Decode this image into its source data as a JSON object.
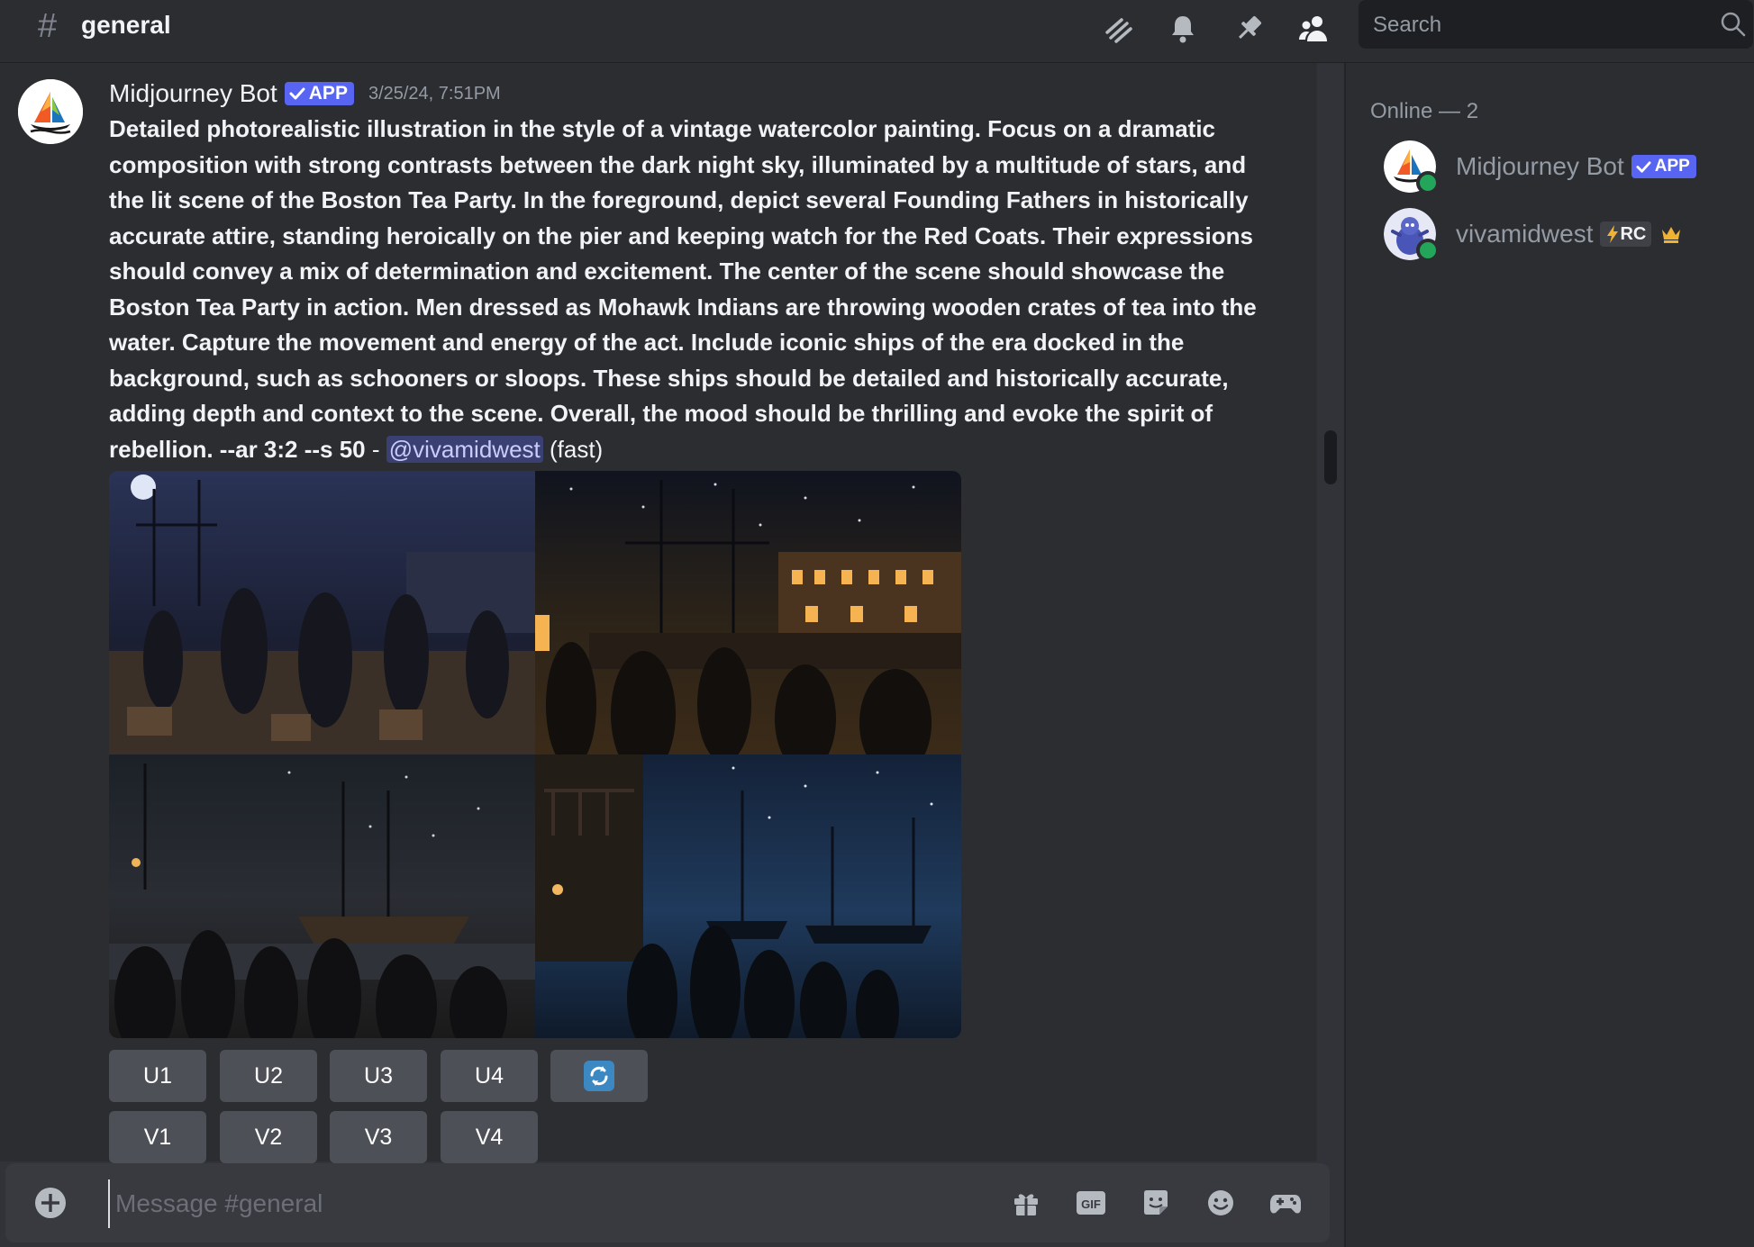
{
  "header": {
    "channel_symbol": "#",
    "channel_name": "general",
    "icons": [
      "threads-icon",
      "bell-icon",
      "pin-icon",
      "members-icon"
    ],
    "search_placeholder": "Search"
  },
  "message": {
    "author": "Midjourney Bot",
    "badge": "APP",
    "timestamp": "3/25/24, 7:51PM",
    "prompt": "Detailed photorealistic illustration in the style of a vintage watercolor painting. Focus on a dramatic composition with strong contrasts between the dark night sky, illuminated by a multitude of stars, and the lit scene of the Boston Tea Party. In the foreground, depict several Founding Fathers in historically accurate attire, standing heroically on the pier and keeping watch for the Red Coats. Their expressions should convey a mix of determination and excitement. The center of the scene should showcase the Boston Tea Party in action. Men dressed as Mohawk Indians are throwing wooden crates of tea into the water. Capture the movement and energy of the act. Include iconic ships of the era docked in the background, such as schooners or sloops. These ships should be detailed and historically accurate, adding depth and context to the scene. Overall, the mood should be thrilling and evoke the spirit of rebellion. --ar 3:2 --s 50",
    "separator": " - ",
    "mention": "@vivamidwest",
    "speed": "(fast)"
  },
  "buttons": {
    "upscale": [
      "U1",
      "U2",
      "U3",
      "U4"
    ],
    "variation": [
      "V1",
      "V2",
      "V3",
      "V4"
    ],
    "reroll_icon": "refresh-icon"
  },
  "composer": {
    "placeholder": "Message #general",
    "icons": [
      "gift-icon",
      "gif-icon",
      "sticker-icon",
      "emoji-icon",
      "game-controller-icon"
    ],
    "gif_label": "GIF"
  },
  "members": {
    "online_header": "Online — 2",
    "list": [
      {
        "name": "Midjourney Bot",
        "badge": "APP",
        "status": "online"
      },
      {
        "name": "vivamidwest",
        "badge": "RC",
        "badge_icon": "lightning-icon",
        "extra_icon": "crown-icon",
        "status": "online"
      }
    ]
  },
  "colors": {
    "accent": "#5865f2",
    "online": "#23a55a",
    "background": "#2b2d31",
    "button": "#4e5058"
  }
}
